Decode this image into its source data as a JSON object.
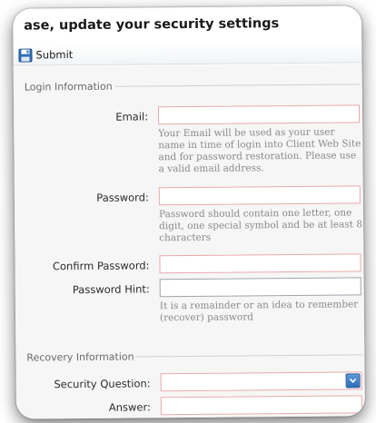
{
  "window": {
    "title": "ase, update your security settings"
  },
  "toolbar": {
    "submit_label": "Submit",
    "submit_icon": "floppy-disk-icon"
  },
  "login_section": {
    "legend": "Login Information",
    "email": {
      "label": "Email:",
      "value": "",
      "hint": "Your Email will be used as your user name in time of login into Client Web Site and for password restoration. Please use a valid email address."
    },
    "password": {
      "label": "Password:",
      "value": "",
      "hint": "Password should contain one letter, one digit, one special symbol and be at least 8 characters"
    },
    "confirm_password": {
      "label": "Confirm Password:",
      "value": ""
    },
    "password_hint": {
      "label": "Password Hint:",
      "value": "",
      "hint": "It is a remainder or an idea to remember (recover) password"
    }
  },
  "recovery_section": {
    "legend": "Recovery Information",
    "security_question": {
      "label": "Security Question:",
      "selected": ""
    },
    "answer": {
      "label": "Answer:",
      "value": ""
    }
  },
  "colors": {
    "required_border": "#e9a9ad",
    "dropdown_accent": "#3a7cc4",
    "hint_text": "#8a8a8a"
  }
}
